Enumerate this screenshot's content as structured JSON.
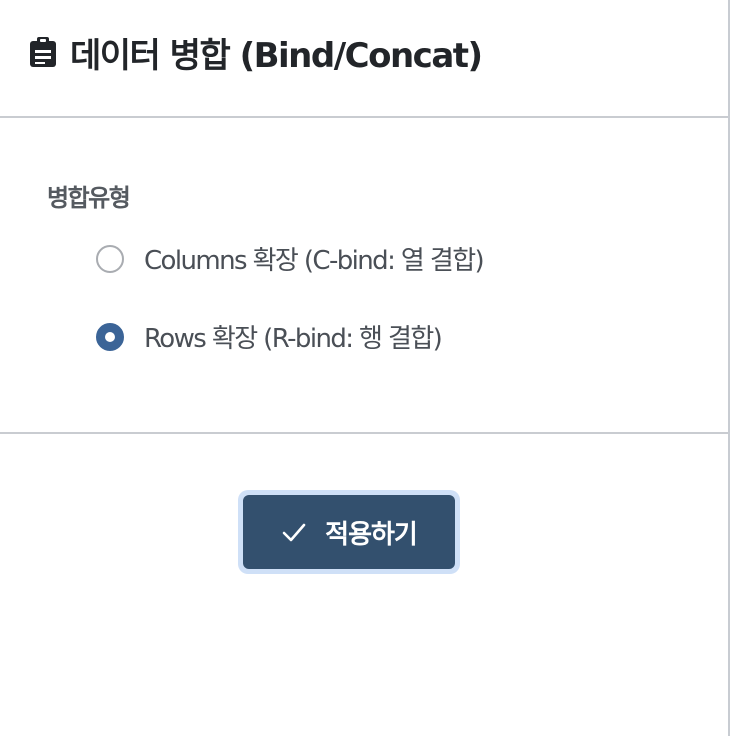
{
  "header": {
    "icon": "clipboard-icon",
    "title": "데이터 병합 (Bind/Concat)"
  },
  "options": {
    "label": "병합유형",
    "items": [
      {
        "label": "Columns 확장 (C-bind: 열 결합)",
        "selected": false
      },
      {
        "label": "Rows 확장 (R-bind: 행 결합)",
        "selected": true
      }
    ]
  },
  "actions": {
    "apply_icon": "check-icon",
    "apply_label": "적용하기"
  },
  "colors": {
    "accent": "#3b6497",
    "button_bg": "#33506e",
    "button_ring": "#cfe0f7"
  }
}
